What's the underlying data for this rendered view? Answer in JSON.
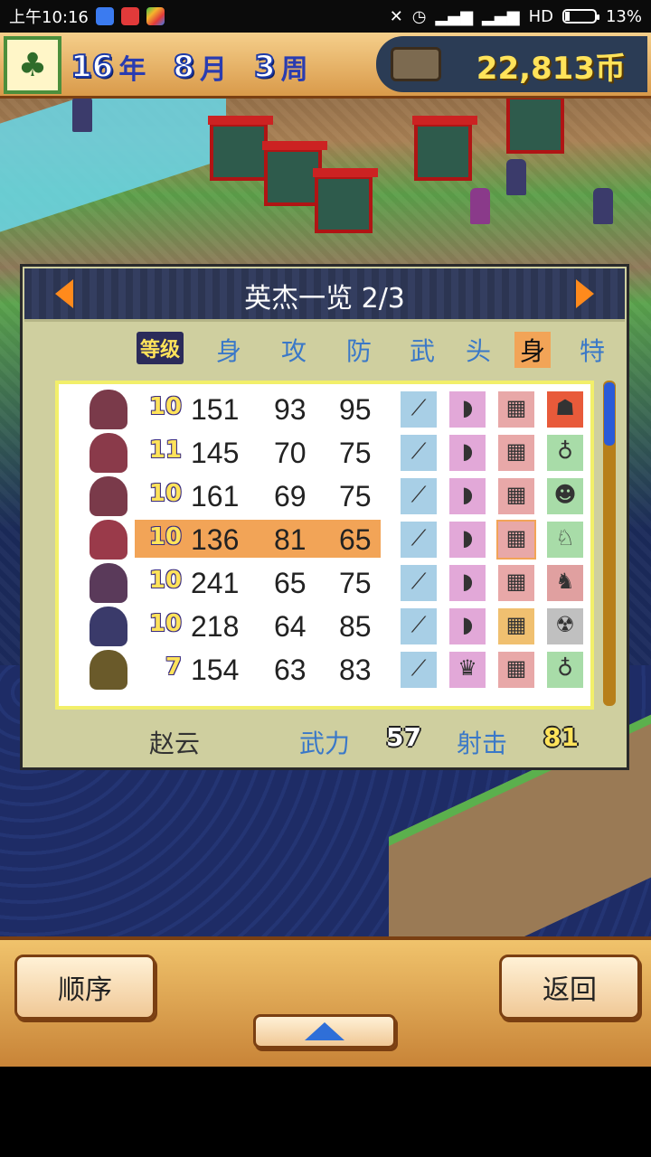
{
  "status_bar": {
    "time": "上午10:16",
    "network": "HD",
    "battery": "13%"
  },
  "top_bar": {
    "year": "16",
    "year_unit": "年",
    "month": "8",
    "month_unit": "月",
    "week": "3",
    "week_unit": "周",
    "money": "22,813币"
  },
  "panel": {
    "title": "英杰一览 2/3",
    "headers": {
      "rank": "等级",
      "body": "身",
      "attack": "攻",
      "defense": "防",
      "weapon": "武",
      "head": "头",
      "armor": "身",
      "special": "特"
    },
    "rows": [
      {
        "level": "10",
        "hp": "151",
        "atk": "93",
        "def": "95"
      },
      {
        "level": "11",
        "hp": "145",
        "atk": "70",
        "def": "75"
      },
      {
        "level": "10",
        "hp": "161",
        "atk": "69",
        "def": "75"
      },
      {
        "level": "10",
        "hp": "136",
        "atk": "81",
        "def": "65"
      },
      {
        "level": "10",
        "hp": "241",
        "atk": "65",
        "def": "75"
      },
      {
        "level": "10",
        "hp": "218",
        "atk": "64",
        "def": "85"
      },
      {
        "level": "7",
        "hp": "154",
        "atk": "63",
        "def": "83"
      }
    ],
    "selected_index": 3,
    "footer": {
      "name": "赵云",
      "stat1_label": "武力",
      "stat1_value": "57",
      "stat2_label": "射击",
      "stat2_value": "81"
    }
  },
  "buttons": {
    "order": "顺序",
    "back": "返回"
  },
  "colors": {
    "highlight": "#f2a457",
    "panel_bg": "#cfcf9f",
    "header_blue": "#3a78c8"
  }
}
